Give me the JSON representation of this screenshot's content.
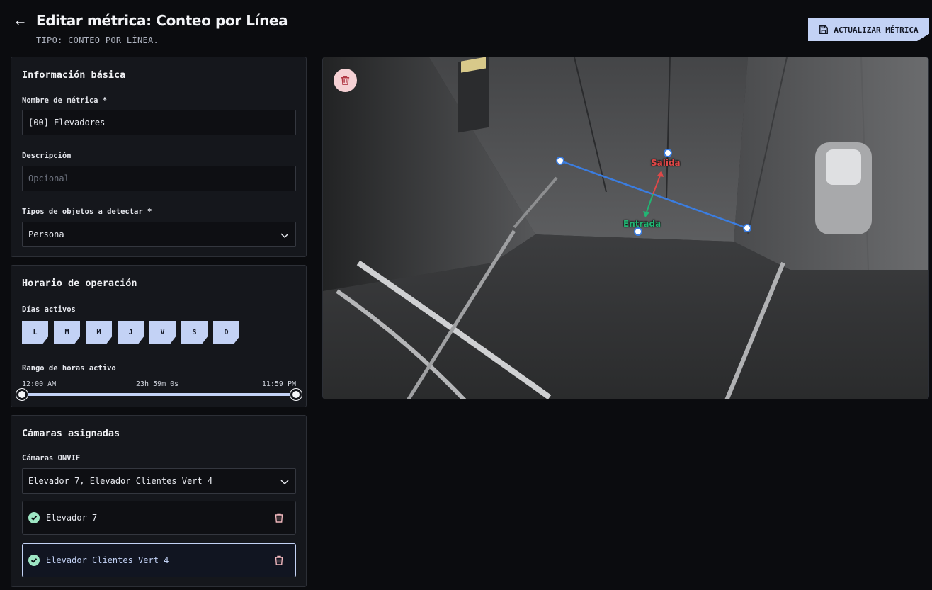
{
  "header": {
    "title": "Editar métrica: Conteo por Línea",
    "subtitle": "TIPO: CONTEO POR LÍNEA.",
    "update_button": "ACTUALIZAR MÉTRICA"
  },
  "basic_info": {
    "title": "Información básica",
    "name_label": "Nombre de métrica *",
    "name_value": "[00] Elevadores",
    "description_label": "Descripción",
    "description_placeholder": "Opcional",
    "object_types_label": "Tipos de objetos a detectar *",
    "object_types_value": "Persona"
  },
  "schedule": {
    "title": "Horario de operación",
    "days_label": "Días activos",
    "days": [
      "L",
      "M",
      "M",
      "J",
      "V",
      "S",
      "D"
    ],
    "range_label": "Rango de horas activo",
    "range_start": "12:00 AM",
    "range_duration": "23h 59m 0s",
    "range_end": "11:59 PM"
  },
  "cameras": {
    "title": "Cámaras asignadas",
    "onvif_label": "Cámaras ONVIF",
    "onvif_value": "Elevador 7, Elevador Clientes Vert 4",
    "items": [
      {
        "name": "Elevador 7",
        "selected": false
      },
      {
        "name": "Elevador Clientes Vert 4",
        "selected": true
      }
    ]
  },
  "video": {
    "exit_label": "Salida",
    "entry_label": "Entrada"
  },
  "colors": {
    "accent": "#c3d2f5",
    "line": "#3b7de0",
    "exit": "#e04848",
    "entry": "#22b573"
  },
  "icons": [
    "back-arrow-icon",
    "save-icon",
    "chevron-down-icon",
    "check-circle-icon",
    "trash-icon"
  ]
}
